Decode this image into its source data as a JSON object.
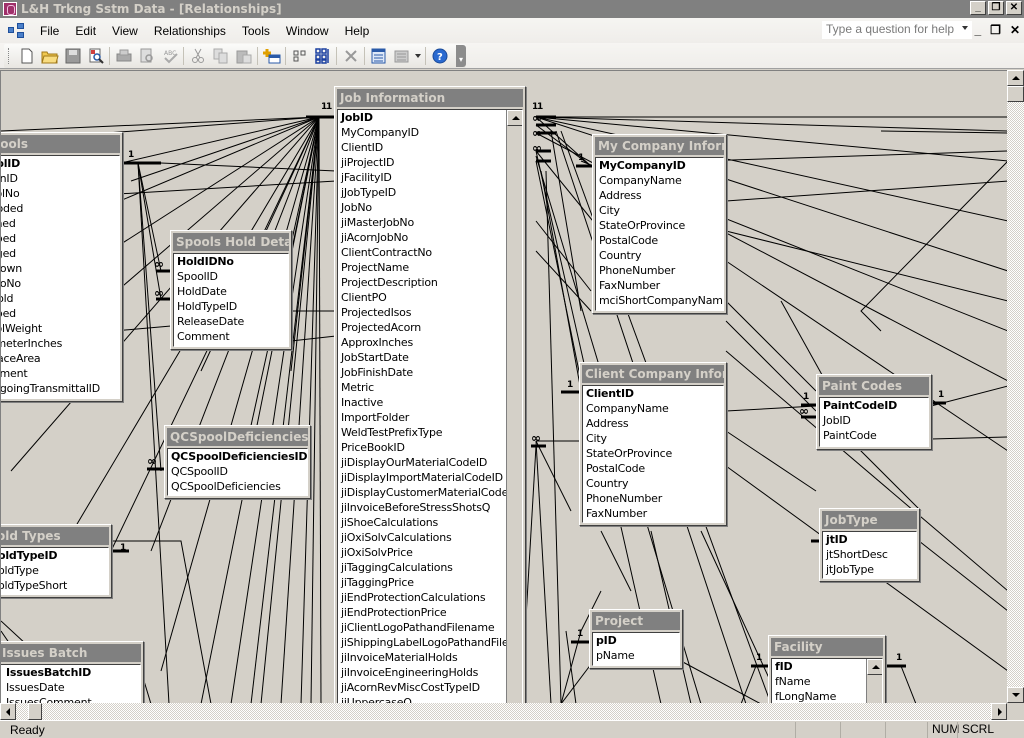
{
  "window": {
    "title": "L&H Trkng Sstm Data - [Relationships]",
    "controls": [
      "minimize",
      "restore",
      "close"
    ]
  },
  "menubar": {
    "items": [
      "File",
      "Edit",
      "View",
      "Relationships",
      "Tools",
      "Window",
      "Help"
    ],
    "help_placeholder": "Type a question for help"
  },
  "toolbar": {
    "buttons": [
      "new",
      "open",
      "save",
      "file-search",
      "print",
      "print-preview",
      "spelling",
      "cut",
      "copy",
      "paste",
      "show-table",
      "show-direct",
      "show-all",
      "delete",
      "database-window",
      "new-object",
      "help"
    ]
  },
  "tables": {
    "spools": {
      "title": "Spools",
      "fields": [
        "SpoolID",
        "AcornID",
        "SpoolNo",
        "IsCoded",
        "Cleaned",
        "Shipped",
        "Tagged",
        "Teardown",
        "HydroNo",
        "OnHold",
        "Stopped",
        "SpoolWeight",
        "DiameterInches",
        "SurfaceArea",
        "Comment",
        "OutgoingTransmittalID"
      ],
      "visible_fields": [
        "oolID",
        "ornID",
        "oolNo",
        "Coded",
        "aned",
        "pped",
        "gged",
        "rdown",
        "droNo",
        "Hold",
        "pped",
        "oolWeight",
        "ameterInches",
        "rfaceArea",
        "mment",
        "utgoingTransmittalID"
      ]
    },
    "spools_hold_details": {
      "title": "Spools Hold Details",
      "fields": [
        "HoldIDNo",
        "SpoolID",
        "HoldDate",
        "HoldTypeID",
        "ReleaseDate",
        "Comment"
      ]
    },
    "qc_spool_deficiencies": {
      "title": "QCSpoolDeficiencies",
      "fields": [
        "QCSpoolDeficienciesID",
        "QCSpoolID",
        "QCSpoolDeficiencies"
      ]
    },
    "hold_types": {
      "title": "old Types",
      "fields": [
        "oldTypeID",
        "oldType",
        "oldTypeShort"
      ]
    },
    "issues_batch": {
      "title": "Issues Batch",
      "fields": [
        "IssuesBatchID",
        "IssuesDate",
        "IssuesComment"
      ]
    },
    "job_information": {
      "title": "Job Information",
      "fields": [
        "JobID",
        "MyCompanyID",
        "ClientID",
        "jiProjectID",
        "jFacilityID",
        "jJobTypeID",
        "JobNo",
        "jiMasterJobNo",
        "jiAcornJobNo",
        "ClientContractNo",
        "ProjectName",
        "ProjectDescription",
        "ClientPO",
        "ProjectedIsos",
        "ProjectedAcorn",
        "ApproxInches",
        "JobStartDate",
        "JobFinishDate",
        "Metric",
        "Inactive",
        "ImportFolder",
        "WeldTestPrefixType",
        "PriceBookID",
        "jiDisplayOurMaterialCodeID",
        "jiDisplayImportMaterialCodeID",
        "jiDisplayCustomerMaterialCodeID",
        "jiInvoiceBeforeStressShotsQ",
        "jiShoeCalculations",
        "jiOxiSolvCalculations",
        "jiOxiSolvPrice",
        "jiTaggingCalculations",
        "jiTaggingPrice",
        "jiEndProtectionCalculations",
        "jiEndProtectionPrice",
        "jiClientLogoPathandFilename",
        "jiShippingLabelLogoPathandFilename",
        "jiInvoiceMaterialHolds",
        "jiInvoiceEngineeringHolds",
        "jiAcornRevMiscCostTypeID",
        "jiUppercaseQ"
      ]
    },
    "my_company": {
      "title": "My Company Inform...",
      "fields": [
        "MyCompanyID",
        "CompanyName",
        "Address",
        "City",
        "StateOrProvince",
        "PostalCode",
        "Country",
        "PhoneNumber",
        "FaxNumber",
        "mciShortCompanyName"
      ]
    },
    "client_company": {
      "title": "Client Company Inform...",
      "fields": [
        "ClientID",
        "CompanyName",
        "Address",
        "City",
        "StateOrProvince",
        "PostalCode",
        "Country",
        "PhoneNumber",
        "FaxNumber"
      ]
    },
    "paint_codes": {
      "title": "Paint Codes",
      "fields": [
        "PaintCodeID",
        "JobID",
        "PaintCode"
      ]
    },
    "job_type": {
      "title": "JobType",
      "fields": [
        "jtID",
        "jtShortDesc",
        "jtJobType"
      ]
    },
    "project": {
      "title": "Project",
      "fields": [
        "pID",
        "pName"
      ]
    },
    "facility": {
      "title": "Facility",
      "fields": [
        "fID",
        "fName",
        "fLongName"
      ]
    }
  },
  "relationship_labels": {
    "one": "1",
    "many": "∞"
  },
  "statusbar": {
    "status": "Ready",
    "num": "NUM",
    "scrl": "SCRL"
  }
}
